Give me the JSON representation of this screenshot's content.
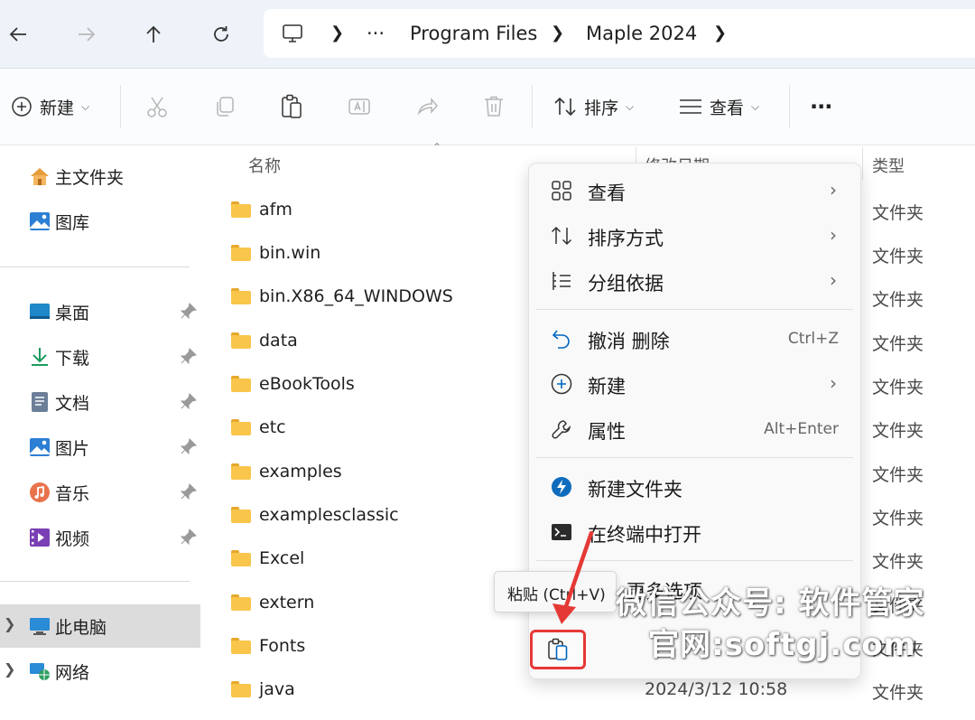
{
  "breadcrumb": {
    "ellipsis": "···",
    "items": [
      "Program Files",
      "Maple 2024"
    ]
  },
  "toolbar": {
    "new_label": "新建",
    "sort_label": "排序",
    "view_label": "查看",
    "more_label": "···"
  },
  "sidebar": {
    "quick": [
      {
        "label": "主文件夹",
        "icon": "home-icon"
      },
      {
        "label": "图库",
        "icon": "gallery-icon"
      }
    ],
    "pinned": [
      {
        "label": "桌面",
        "icon": "desktop-icon"
      },
      {
        "label": "下载",
        "icon": "download-icon"
      },
      {
        "label": "文档",
        "icon": "document-icon"
      },
      {
        "label": "图片",
        "icon": "pictures-icon"
      },
      {
        "label": "音乐",
        "icon": "music-icon"
      },
      {
        "label": "视频",
        "icon": "video-icon"
      }
    ],
    "tree": [
      {
        "label": "此电脑",
        "icon": "computer-icon"
      },
      {
        "label": "网络",
        "icon": "network-icon"
      }
    ]
  },
  "columns": {
    "name": "名称",
    "date": "修改日期",
    "type": "类型"
  },
  "files": [
    {
      "name": "afm",
      "type": "文件夹"
    },
    {
      "name": "bin.win",
      "type": "文件夹"
    },
    {
      "name": "bin.X86_64_WINDOWS",
      "type": "文件夹"
    },
    {
      "name": "data",
      "type": "文件夹"
    },
    {
      "name": "eBookTools",
      "type": "文件夹"
    },
    {
      "name": "etc",
      "type": "文件夹"
    },
    {
      "name": "examples",
      "type": "文件夹"
    },
    {
      "name": "examplesclassic",
      "type": "文件夹"
    },
    {
      "name": "Excel",
      "type": "文件夹"
    },
    {
      "name": "extern",
      "type": "文件夹"
    },
    {
      "name": "Fonts",
      "type": "文件夹"
    },
    {
      "name": "java",
      "type": "文件夹",
      "date": "2024/3/12 10:58"
    }
  ],
  "context_menu": {
    "view": "查看",
    "sort_by": "排序方式",
    "group_by": "分组依据",
    "undo": "撤消 删除",
    "undo_shortcut": "Ctrl+Z",
    "new": "新建",
    "properties": "属性",
    "properties_shortcut": "Alt+Enter",
    "new_folder": "新建文件夹",
    "open_terminal": "在终端中打开",
    "more_options": "显示更多选项",
    "more_options_visible": "更多选项"
  },
  "tooltip": "粘贴 (Ctrl+V)",
  "watermark": {
    "line1": "微信公众号: 软件管家",
    "line2": "官网:softgj.com"
  },
  "colors": {
    "accent": "#0067c0",
    "highlight": "#e53935",
    "folder": "#f9c54a"
  }
}
